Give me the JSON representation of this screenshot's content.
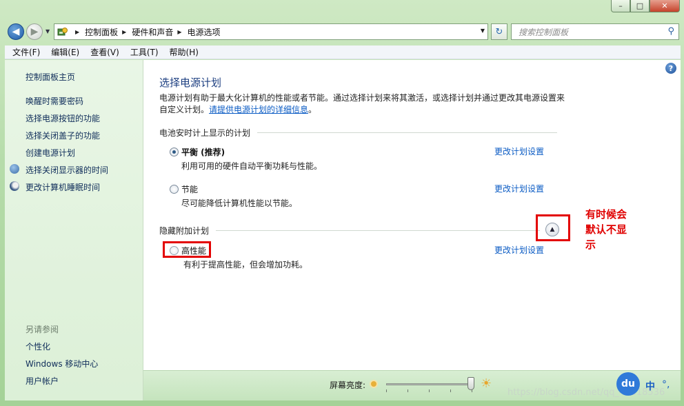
{
  "window": {
    "min": "–",
    "max": "□",
    "close": "✕"
  },
  "nav": {
    "breadcrumb": [
      "控制面板",
      "硬件和声音",
      "电源选项"
    ],
    "search_placeholder": "搜索控制面板"
  },
  "menu": [
    "文件(F)",
    "编辑(E)",
    "查看(V)",
    "工具(T)",
    "帮助(H)"
  ],
  "sidebar": {
    "home": "控制面板主页",
    "links": [
      "唤醒时需要密码",
      "选择电源按钮的功能",
      "选择关闭盖子的功能",
      "创建电源计划",
      "选择关闭显示器的时间",
      "更改计算机睡眠时间"
    ],
    "see_also_title": "另请参阅",
    "see_also": [
      "个性化",
      "Windows 移动中心",
      "用户帐户"
    ]
  },
  "main": {
    "title": "选择电源计划",
    "desc": "电源计划有助于最大化计算机的性能或者节能。通过选择计划来将其激活，或选择计划并通过更改其电源设置来自定义计划。",
    "desc_link": "请提供电源计划的详细信息",
    "group1": "电池安时计上显示的计划",
    "group2": "隐藏附加计划",
    "change_link": "更改计划设置",
    "plans": [
      {
        "name": "平衡 (推荐)",
        "desc": "利用可用的硬件自动平衡功耗与性能。",
        "selected": true
      },
      {
        "name": "节能",
        "desc": "尽可能降低计算机性能以节能。",
        "selected": false
      },
      {
        "name": "高性能",
        "desc": "有利于提高性能，但会增加功耗。",
        "selected": false
      }
    ],
    "annotation": [
      "有时候会",
      "默认不显",
      "示"
    ]
  },
  "bottom": {
    "brightness_label": "屏幕亮度:",
    "brightness_level": 1.0,
    "watermark": "https://blog.csdn.net/qq_41618536",
    "ime_badge": "du",
    "ime_char": "中",
    "ime_extra": "°,"
  },
  "colors": {
    "link": "#0a5bc4",
    "title": "#1c3e80",
    "annotation": "#e00000",
    "frame": "#b6dcaa"
  }
}
